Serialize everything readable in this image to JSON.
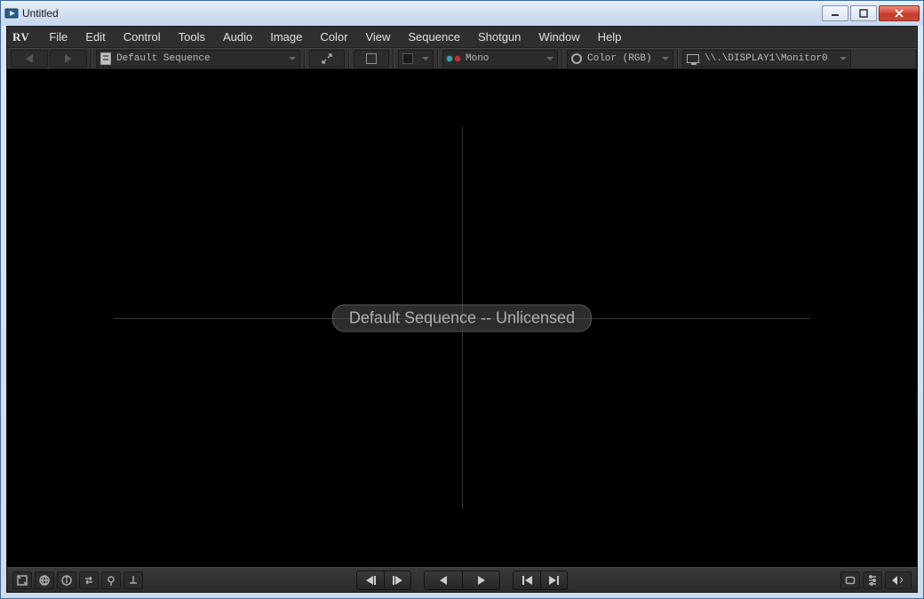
{
  "window": {
    "title": "Untitled"
  },
  "menubar": {
    "logo": "RV",
    "items": [
      "File",
      "Edit",
      "Control",
      "Tools",
      "Audio",
      "Image",
      "Color",
      "View",
      "Sequence",
      "Shotgun",
      "Window",
      "Help"
    ]
  },
  "toolbar": {
    "sequence_selector": "Default Sequence",
    "stereo_mode": "Mono",
    "color_mode": "Color (RGB)",
    "display_device": "\\\\.\\DISPLAY1\\Monitor0"
  },
  "viewport": {
    "center_label": "Default Sequence -- Unlicensed"
  }
}
